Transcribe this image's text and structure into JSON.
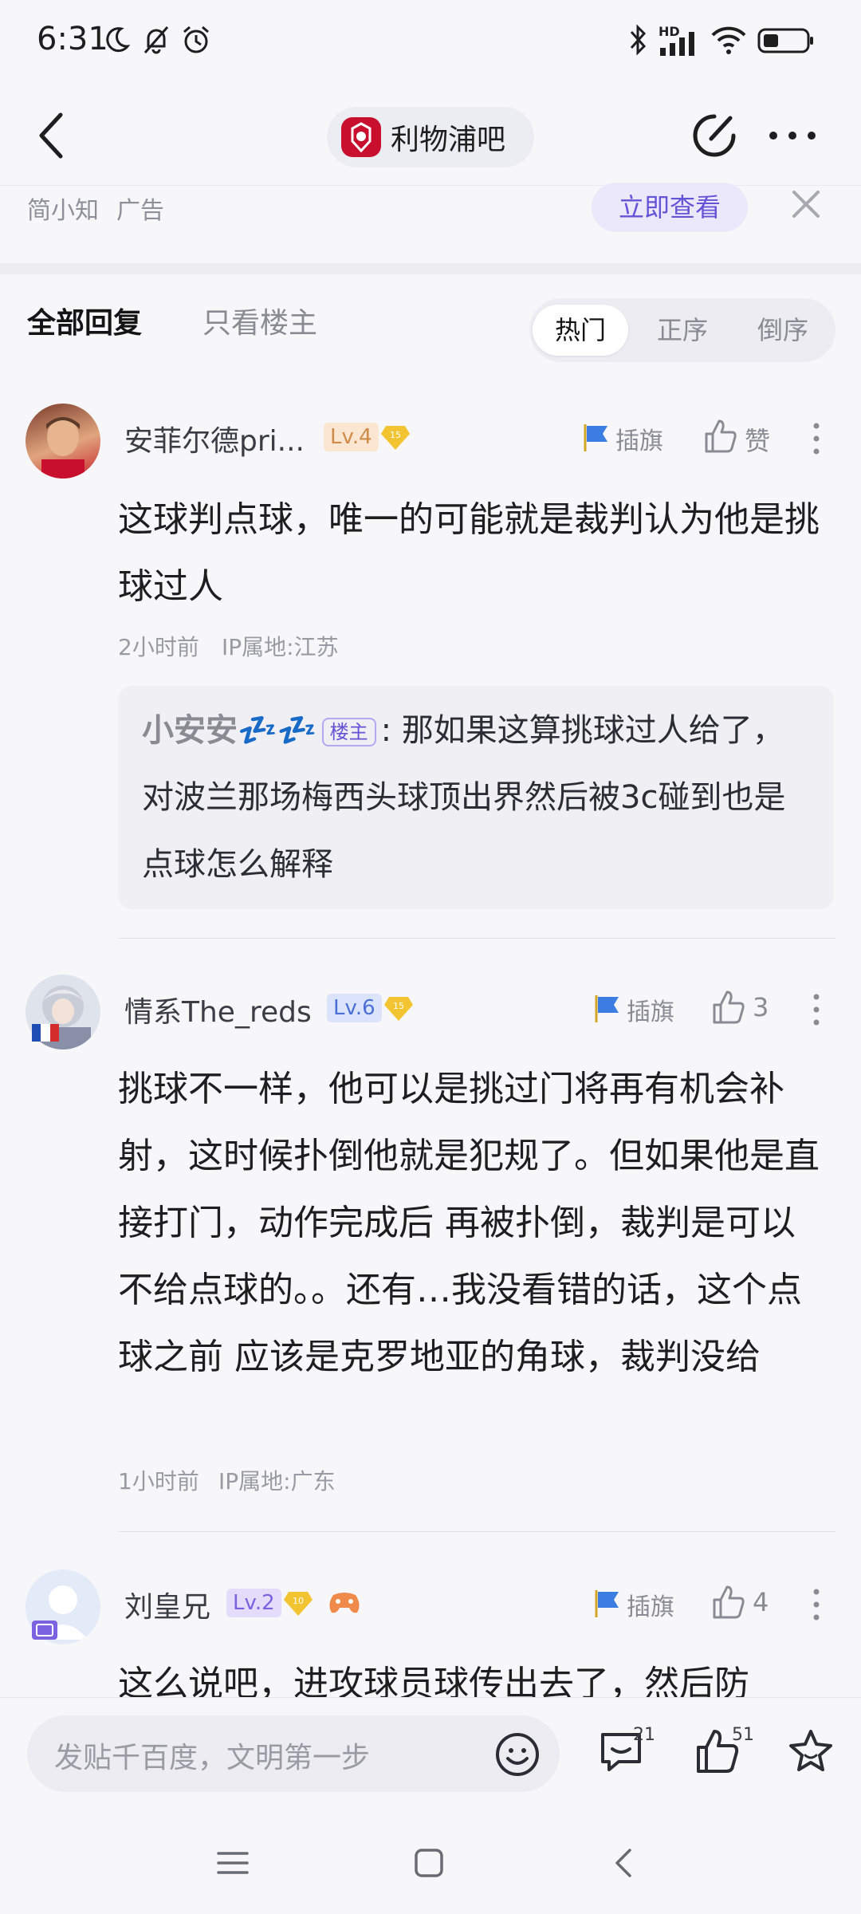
{
  "status": {
    "time": "6:31",
    "network": "HD"
  },
  "header": {
    "forum_name": "利物浦吧"
  },
  "ad": {
    "source": "简小知",
    "label": "广告",
    "cta": "立即查看"
  },
  "tabs": {
    "all": "全部回复",
    "op_only": "只看楼主"
  },
  "sort": {
    "hot": "热门",
    "asc": "正序",
    "desc": "倒序",
    "active": "hot"
  },
  "posts": [
    {
      "username": "安菲尔德pri...",
      "level": "Lv.4",
      "gem_level": "15",
      "flag_label": "插旗",
      "like_label": "赞",
      "content": "这球判点球，唯一的可能就是裁判认为他是挑球过人",
      "time": "2小时前",
      "ip": "IP属地:江苏",
      "reply": {
        "author": "小安安💤💤",
        "op_badge": "楼主",
        "text": "那如果这算挑球过人给了，对波兰那场梅西头球顶出界然后被3c碰到也是点球怎么解释"
      }
    },
    {
      "username": "情系The_reds",
      "level": "Lv.6",
      "gem_level": "15",
      "flag_label": "插旗",
      "like_label": "3",
      "content": "挑球不一样，他可以是挑过门将再有机会补射，这时候扑倒他就是犯规了。但如果他是直接打门，动作完成后 再被扑倒，裁判是可以不给点球的。。还有…我没看错的话，这个点球之前 应该是克罗地亚的角球，裁判没给",
      "time": "1小时前",
      "ip": "IP属地:广东"
    },
    {
      "username": "刘皇兄",
      "level": "Lv.2",
      "gem_level": "10",
      "flag_label": "插旗",
      "like_label": "4",
      "content": "这么说吧，进攻球员球传出去了，然后防"
    }
  ],
  "bottom": {
    "placeholder": "发贴千百度，文明第一步",
    "comment_count": "21",
    "like_count": "51"
  },
  "colors": {
    "accent": "#6453d6",
    "background": "#f7f7fa",
    "text": "#1e1e1e",
    "muted": "#8a8a92"
  }
}
